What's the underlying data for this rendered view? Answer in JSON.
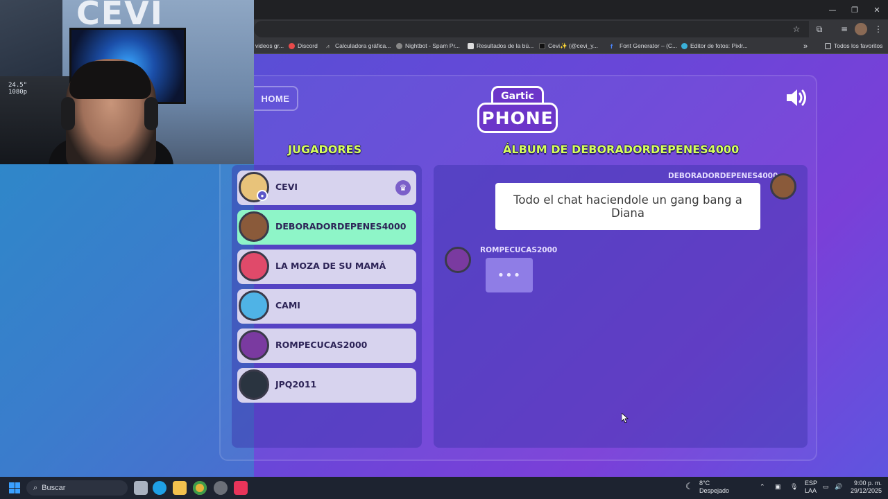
{
  "browser": {
    "bookmarks": [
      "videos gr...",
      "Discord",
      "Calculadora gráfica...",
      "Nightbot - Spam Pr...",
      "Resultados de la bú...",
      "Cevi✨ (@cevi_y...",
      "Font Generator – (C...",
      "Editor de fotos: Pixlr..."
    ],
    "all_bookmarks": "Todos los favoritos",
    "overflow": "»"
  },
  "webcam": {
    "logo_text": "CEVI",
    "shelf_label_1": "24.5\"",
    "shelf_label_2": "1080p"
  },
  "game": {
    "home_label": "HOME",
    "logo_top": "Gartic",
    "logo_main": "PHONE",
    "players_heading": "JUGADORES",
    "album_heading": "ÁLBUM DE DEBORADORDEPENES4000",
    "players": [
      {
        "name": "CEVI",
        "host": true,
        "active": false,
        "avatar_color": "#e8c37a"
      },
      {
        "name": "DEBORADORDEPENES4000",
        "host": false,
        "active": true,
        "avatar_color": "#8a5a3a"
      },
      {
        "name": "LA MOZA DE SU MAMÁ",
        "host": false,
        "active": false,
        "avatar_color": "#e04a6a"
      },
      {
        "name": "CAMI",
        "host": false,
        "active": false,
        "avatar_color": "#4fb3e6"
      },
      {
        "name": "ROMPECUCAS2000",
        "host": false,
        "active": false,
        "avatar_color": "#7a3aa0"
      },
      {
        "name": "JPQ2011",
        "host": false,
        "active": false,
        "avatar_color": "#2a3440"
      }
    ],
    "album": {
      "entry1_author": "DEBORADORDEPENES4000",
      "entry1_text": "Todo el chat haciendole un gang bang a Diana",
      "entry2_author": "ROMPECUCAS2000",
      "entry2_typing": "•••"
    },
    "colors": {
      "active_player": "#8ef5c8",
      "heading": "#d6ff5a",
      "player_bg": "#d7d3ee"
    }
  },
  "taskbar": {
    "search_label": "Buscar",
    "weather_temp": "8°C",
    "weather_desc": "Despejado",
    "lang_1": "ESP",
    "lang_2": "LAA",
    "time": "9:00 p. m.",
    "date": "29/12/2025"
  }
}
